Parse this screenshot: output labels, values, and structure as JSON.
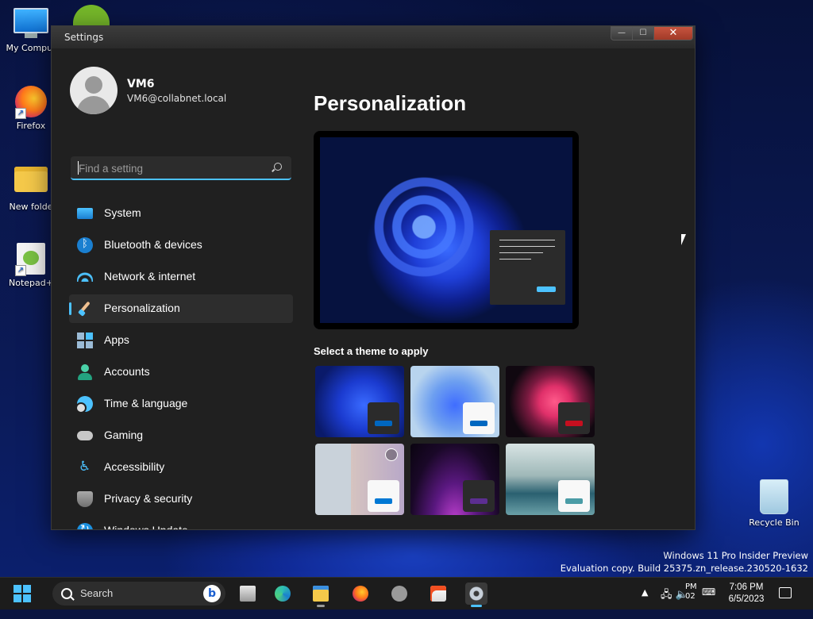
{
  "desktop": {
    "icons": [
      {
        "label": "My Comput",
        "icon": "computer-icon"
      },
      {
        "label": "Firefox",
        "icon": "firefox-icon"
      },
      {
        "label": "New folde",
        "icon": "folder-icon"
      },
      {
        "label": "Notepad+",
        "icon": "notepadpp-icon"
      },
      {
        "label": "Recycle Bin",
        "icon": "recycle-bin-icon"
      }
    ],
    "watermark": {
      "line1": "Windows 11 Pro Insider Preview",
      "line2": "Evaluation copy. Build 25375.zn_release.230520-1632"
    }
  },
  "window": {
    "title": "Settings",
    "controls": {
      "minimize": "—",
      "maximize": "☐",
      "close": "✕"
    }
  },
  "user": {
    "name": "VM6",
    "email": "VM6@collabnet.local"
  },
  "search": {
    "placeholder": "Find a setting",
    "value": ""
  },
  "nav": {
    "items": [
      {
        "label": "System",
        "icon": "system-icon"
      },
      {
        "label": "Bluetooth & devices",
        "icon": "bluetooth-icon"
      },
      {
        "label": "Network & internet",
        "icon": "wifi-icon"
      },
      {
        "label": "Personalization",
        "icon": "brush-icon",
        "active": true
      },
      {
        "label": "Apps",
        "icon": "apps-icon"
      },
      {
        "label": "Accounts",
        "icon": "account-icon"
      },
      {
        "label": "Time & language",
        "icon": "clock-globe-icon"
      },
      {
        "label": "Gaming",
        "icon": "gamepad-icon"
      },
      {
        "label": "Accessibility",
        "icon": "accessibility-icon"
      },
      {
        "label": "Privacy & security",
        "icon": "shield-icon"
      },
      {
        "label": "Windows Update",
        "icon": "update-icon"
      }
    ]
  },
  "main": {
    "title": "Personalization",
    "theme_section_label": "Select a theme to apply",
    "themes": [
      {
        "name": "windows-dark",
        "accent": "#0067c0"
      },
      {
        "name": "windows-light",
        "accent": "#0067c0"
      },
      {
        "name": "glow",
        "accent": "#c50f1f"
      },
      {
        "name": "captured-motion",
        "accent": "#0078d4"
      },
      {
        "name": "sunrise",
        "accent": "#5c2e91"
      },
      {
        "name": "flow",
        "accent": "#4a9ca6"
      }
    ]
  },
  "colors": {
    "accent": "#4cc2ff",
    "window_bg": "#202020",
    "active_nav_bg": "#2d2d2d"
  },
  "taskbar": {
    "search_label": "Search",
    "bing_label": "b",
    "apps": [
      {
        "name": "task-view",
        "icon": "task-view-icon"
      },
      {
        "name": "edge",
        "icon": "edge-icon"
      },
      {
        "name": "file-explorer",
        "icon": "folder-icon"
      },
      {
        "name": "firefox",
        "icon": "firefox-icon"
      },
      {
        "name": "tools",
        "icon": "tools-icon"
      },
      {
        "name": "store",
        "icon": "store-icon"
      },
      {
        "name": "settings",
        "icon": "gear-icon",
        "active": true
      }
    ],
    "tray": {
      "chevron": "▲",
      "pm_fragment": "PM",
      "date_fragment": "02",
      "keyboard": "⌨",
      "time": "7:06 PM",
      "date": "6/5/2023"
    }
  }
}
